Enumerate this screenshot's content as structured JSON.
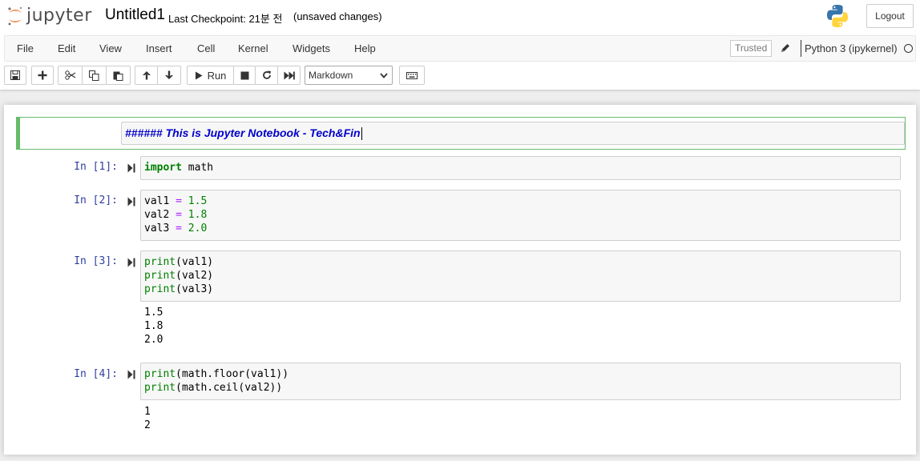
{
  "header": {
    "logo_text": "jupyter",
    "notebook_name": "Untitled1",
    "checkpoint": "Last Checkpoint: 21분 전",
    "autosave_status": "(unsaved changes)",
    "logout_label": "Logout"
  },
  "menubar": {
    "items": [
      "File",
      "Edit",
      "View",
      "Insert",
      "Cell",
      "Kernel",
      "Widgets",
      "Help"
    ],
    "trusted_label": "Trusted",
    "kernel_name": "Python 3 (ipykernel)",
    "kernel_status": "idle"
  },
  "toolbar": {
    "run_label": "Run",
    "cell_type": "Markdown",
    "buttons": [
      "save-icon",
      "plus-icon",
      "cut-icon",
      "copy-icon",
      "paste-icon",
      "arrow-up-icon",
      "arrow-down-icon",
      "run-icon",
      "stop-icon",
      "restart-icon",
      "fast-forward-icon",
      "keyboard-icon"
    ]
  },
  "cells": {
    "markdown": {
      "source": "###### This is Jupyter Notebook - Tech&Fin"
    },
    "code": [
      {
        "prompt": "In [1]:",
        "source": "import math",
        "output": ""
      },
      {
        "prompt": "In [2]:",
        "source": "val1 = 1.5\nval2 = 1.8\nval3 = 2.0",
        "output": ""
      },
      {
        "prompt": "In [3]:",
        "source": "print(val1)\nprint(val2)\nprint(val3)",
        "output": "1.5\n1.8\n2.0"
      },
      {
        "prompt": "In [4]:",
        "source": "print(math.floor(val1))\nprint(math.ceil(val2))",
        "output": "1\n2"
      }
    ]
  },
  "colors": {
    "prompt": "#303f9f",
    "keyword": "#008000",
    "operator": "#aa22ff",
    "selected_cell_border": "#66bb6a",
    "markdown_text": "#0000cc"
  }
}
